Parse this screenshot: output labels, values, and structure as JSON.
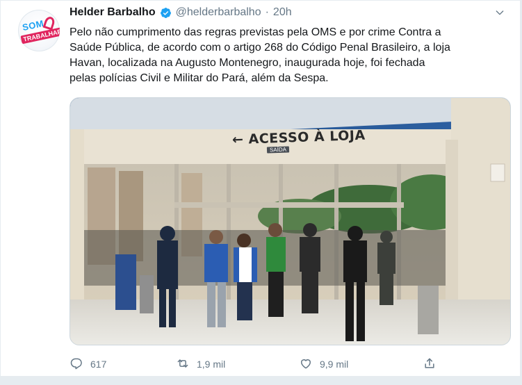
{
  "tweet": {
    "author_name": "Helder Barbalho",
    "handle": "@helderbarbalho",
    "separator": "·",
    "time": "20h",
    "text": "Pelo não cumprimento das regras previstas pela OMS e por crime Contra a\nSaúde Pública, de acordo com o artigo 268 do Código Penal Brasileiro, a loja\nHavan, localizada na Augusto Montenegro, inaugurada hoje, foi fechada\npelas polícias Civil e Militar do Pará, além da Sespa.",
    "avatar_text_top": "SOM",
    "avatar_text_bottom": "TRABALHAR",
    "icons": {
      "verified": "verified-badge-icon",
      "more": "chevron-down-icon",
      "reply": "reply-icon",
      "retweet": "retweet-icon",
      "like": "heart-icon",
      "share": "share-icon"
    }
  },
  "media": {
    "sign_text": "← ACESSO À LOJA",
    "sign_subtext": "SAÍDA"
  },
  "actions": {
    "reply_count": "617",
    "retweet_count": "1,9 mil",
    "like_count": "9,9 mil"
  },
  "colors": {
    "accent": "#1da1f2",
    "secondary_text": "#657786",
    "primary_text": "#14171a",
    "background": "#e6ecf0"
  }
}
